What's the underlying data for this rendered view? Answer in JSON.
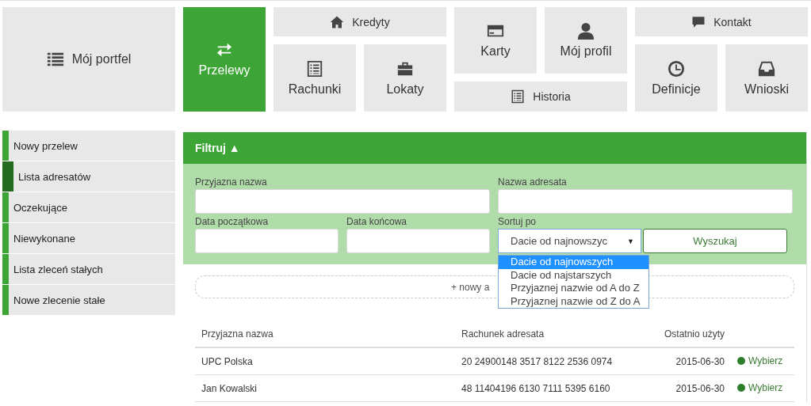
{
  "tiles": [
    {
      "label": "Mój portfel",
      "selected": false
    },
    {
      "label": "Przelewy",
      "selected": true
    },
    {
      "label": "Kredyty",
      "selected": false
    },
    {
      "label": "Rachunki",
      "selected": false
    },
    {
      "label": "Lokaty",
      "selected": false
    },
    {
      "label": "Karty",
      "selected": false
    },
    {
      "label": "Mój profil",
      "selected": false
    },
    {
      "label": "Historia",
      "selected": false
    },
    {
      "label": "Kontakt",
      "selected": false
    },
    {
      "label": "Definicje",
      "selected": false
    },
    {
      "label": "Wnioski",
      "selected": false
    }
  ],
  "sidebar": {
    "items": [
      {
        "label": "Nowy przelew",
        "selected": false
      },
      {
        "label": "Lista adresatów",
        "selected": true
      },
      {
        "label": "Oczekujące",
        "selected": false
      },
      {
        "label": "Niewykonane",
        "selected": false
      },
      {
        "label": "Lista zleceń stałych",
        "selected": false
      },
      {
        "label": "Nowe zlecenie stałe",
        "selected": false
      }
    ]
  },
  "filter": {
    "title": "Filtruj ▲",
    "expanded": true,
    "fields": [
      {
        "label": "Przyjazna nazwa"
      },
      {
        "label": "Nazwa adresata"
      },
      {
        "label": "Data początkowa"
      },
      {
        "label": "Data końcowa"
      }
    ],
    "sort": {
      "label": "Sortuj po",
      "value": "Dacie od najnowszyc",
      "caret": "▼",
      "options": [
        {
          "label": "Dacie od najnowszych",
          "selected": true
        },
        {
          "label": "Dacie od najstarszych",
          "selected": false
        },
        {
          "label": "Przyjaznej nazwie od A do Z",
          "selected": false
        },
        {
          "label": "Przyjaznej nazwie od Z do A",
          "selected": false
        }
      ]
    },
    "search_button": "Wyszukaj"
  },
  "new_recipient": "+ nowy a",
  "table": {
    "columns": [
      "Przyjazna nazwa",
      "Rachunek adresata",
      "Ostatnio użyty"
    ],
    "rows": [
      {
        "name": "UPC Polska",
        "account": "20 24900148 3517 8122 2536 0974",
        "last_used": "2015-06-30",
        "action": "Wybierz"
      },
      {
        "name": "Jan Kowalski",
        "account": "48 11404196 6130 7111 5395 6160",
        "last_used": "2015-06-30",
        "action": "Wybierz"
      }
    ]
  }
}
